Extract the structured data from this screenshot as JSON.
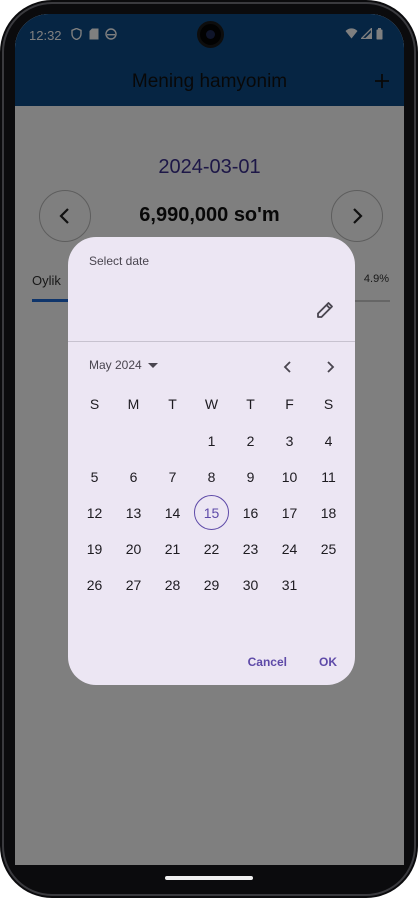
{
  "status_bar": {
    "time": "12:32"
  },
  "app_bar": {
    "title": "Mening hamyonim",
    "add_icon": "plus-icon"
  },
  "main": {
    "date": "2024-03-01",
    "amount": "6,990,000 so'm",
    "tab_label": "Oylik",
    "percent": "4.9%"
  },
  "date_picker": {
    "title": "Select date",
    "month_label": "May 2024",
    "weekdays": [
      "S",
      "M",
      "T",
      "W",
      "T",
      "F",
      "S"
    ],
    "weeks": [
      [
        "",
        "",
        "",
        "1",
        "2",
        "3",
        "4"
      ],
      [
        "5",
        "6",
        "7",
        "8",
        "9",
        "10",
        "11"
      ],
      [
        "12",
        "13",
        "14",
        "15",
        "16",
        "17",
        "18"
      ],
      [
        "19",
        "20",
        "21",
        "22",
        "23",
        "24",
        "25"
      ],
      [
        "26",
        "27",
        "28",
        "29",
        "30",
        "31",
        ""
      ]
    ],
    "highlighted_day": "15",
    "cancel_label": "Cancel",
    "ok_label": "OK"
  },
  "colors": {
    "app_bar": "#0d4a86",
    "accent": "#5e4aa8",
    "dialog_bg": "#ece6f3"
  }
}
